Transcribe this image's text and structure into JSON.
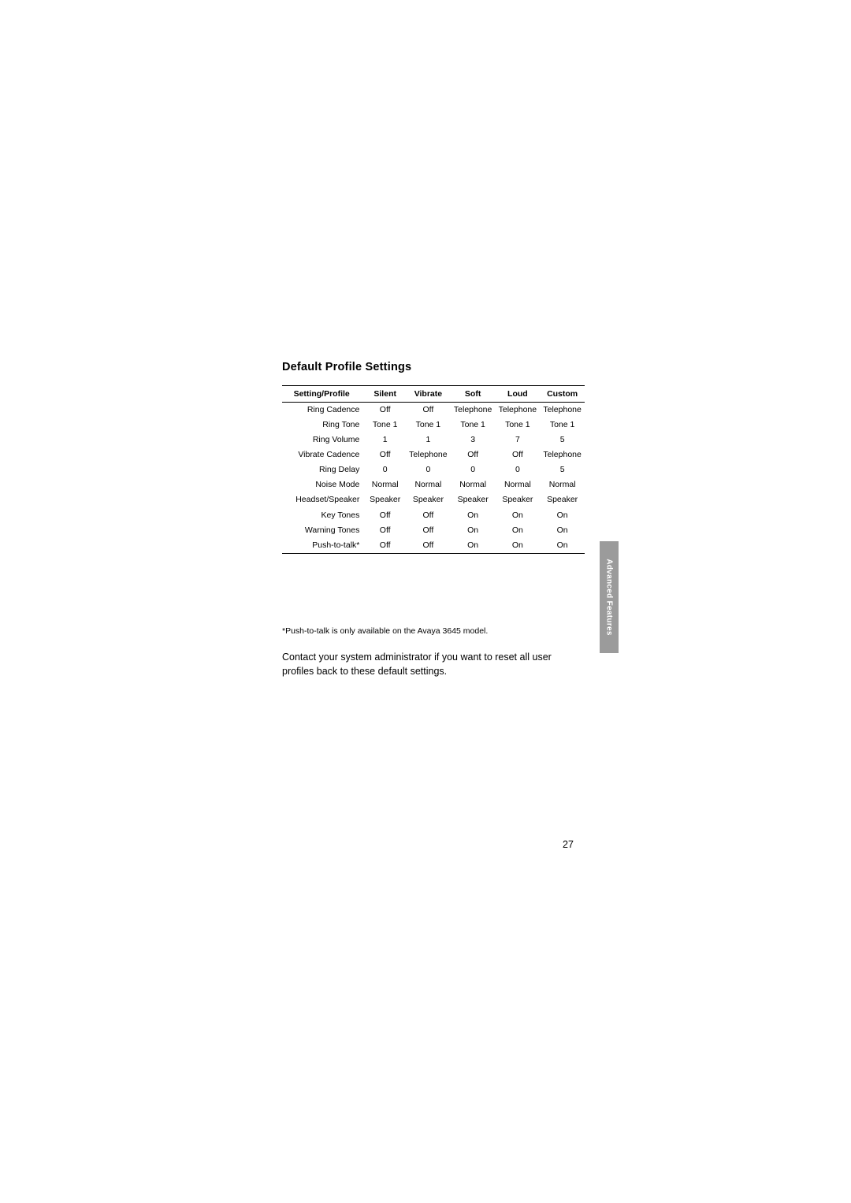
{
  "document": {
    "heading": "Default Profile Settings",
    "footnote": "*Push-to-talk is only available on the Avaya 3645 model.",
    "body_paragraph": "Contact your system administrator if you want to reset all user profiles back to these default settings.",
    "side_tab_label": "Advanced Features",
    "page_number": "27"
  },
  "table": {
    "headers": [
      "Setting/Profile",
      "Silent",
      "Vibrate",
      "Soft",
      "Loud",
      "Custom"
    ],
    "rows": [
      {
        "label": "Ring Cadence",
        "values": [
          "Off",
          "Off",
          "Telephone",
          "Telephone",
          "Telephone"
        ]
      },
      {
        "label": "Ring Tone",
        "values": [
          "Tone 1",
          "Tone 1",
          "Tone 1",
          "Tone 1",
          "Tone 1"
        ]
      },
      {
        "label": "Ring Volume",
        "values": [
          "1",
          "1",
          "3",
          "7",
          "5"
        ]
      },
      {
        "label": "Vibrate Cadence",
        "values": [
          "Off",
          "Telephone",
          "Off",
          "Off",
          "Telephone"
        ]
      },
      {
        "label": "Ring Delay",
        "values": [
          "0",
          "0",
          "0",
          "0",
          "5"
        ]
      },
      {
        "label": "Noise Mode",
        "values": [
          "Normal",
          "Normal",
          "Normal",
          "Normal",
          "Normal"
        ]
      },
      {
        "label": "Headset/Speaker",
        "values": [
          "Speaker",
          "Speaker",
          "Speaker",
          "Speaker",
          "Speaker"
        ]
      },
      {
        "label": "Key Tones",
        "values": [
          "Off",
          "Off",
          "On",
          "On",
          "On"
        ]
      },
      {
        "label": "Warning Tones",
        "values": [
          "Off",
          "Off",
          "On",
          "On",
          "On"
        ]
      },
      {
        "label": "Push-to-talk*",
        "values": [
          "Off",
          "Off",
          "On",
          "On",
          "On"
        ]
      }
    ]
  }
}
